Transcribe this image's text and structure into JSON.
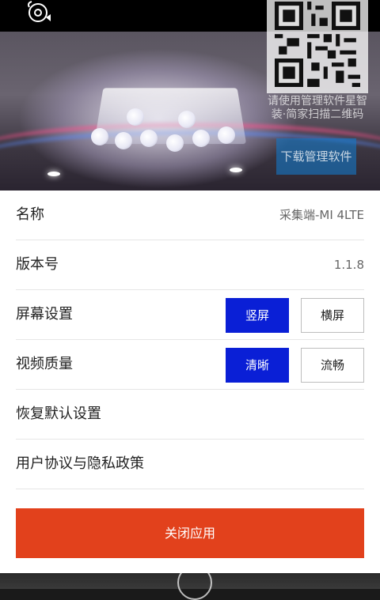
{
  "preview": {
    "qr_caption": "请使用管理软件星智装·简家扫描二维码",
    "download_label": "下载管理软件"
  },
  "settings": {
    "name": {
      "label": "名称",
      "value": "采集端-MI 4LTE"
    },
    "version": {
      "label": "版本号",
      "value": "1.1.8"
    },
    "screen": {
      "label": "屏幕设置",
      "options": [
        "竖屏",
        "横屏"
      ],
      "selected": "竖屏"
    },
    "video_quality": {
      "label": "视频质量",
      "options": [
        "清晰",
        "流畅"
      ],
      "selected": "清晰"
    },
    "restore_defaults": {
      "label": "恢复默认设置"
    },
    "privacy": {
      "label": "用户协议与隐私政策"
    }
  },
  "close_label": "关闭应用",
  "colors": {
    "accent_blue": "#0a1fd6",
    "close_red": "#e2411c",
    "download_blue": "#1478c8"
  },
  "icons": [
    "rotate-camera-icon",
    "qr-code-icon",
    "shutter-icon"
  ]
}
